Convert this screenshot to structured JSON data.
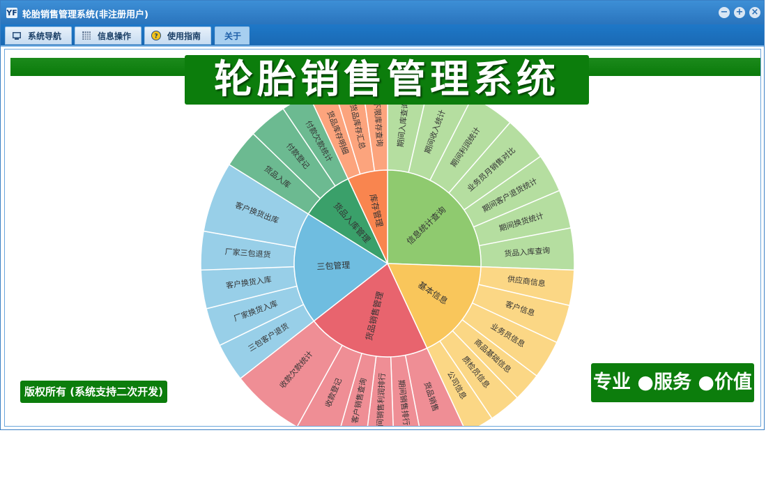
{
  "window": {
    "title": "轮胎销售管理系统(非注册用户)",
    "app_icon_text": "YF"
  },
  "menu": {
    "tabs": [
      {
        "label": "系统导航",
        "icon": "monitor-icon"
      },
      {
        "label": "信息操作",
        "icon": "grid-icon"
      },
      {
        "label": "使用指南",
        "icon": "help-icon"
      },
      {
        "label": "关于",
        "icon": ""
      }
    ],
    "active": "关于"
  },
  "banner": {
    "title": "轮胎销售管理系统"
  },
  "footer": {
    "copyright": "版权所有 (系统支持二次开发)",
    "slogan": "专业 ●服务 ●价值"
  },
  "colors": {
    "green": "#0c7d0c",
    "title_blue": "#3d8fd6",
    "stats": "#8fca6f",
    "basic": "#f9c65b",
    "sales": "#e8646e",
    "warranty": "#6fbde0",
    "stockin": "#3aa06a",
    "inventory": "#f9854f"
  },
  "sunburst": {
    "inner": [
      {
        "label": "信息统计查询",
        "color": "#8fca6f",
        "outer_color": "#b5dea0"
      },
      {
        "label": "基本信息",
        "color": "#f9c65b",
        "outer_color": "#fbd785"
      },
      {
        "label": "货品销售管理",
        "color": "#e8646e",
        "outer_color": "#ef8e95"
      },
      {
        "label": "三包管理",
        "color": "#6fbde0",
        "outer_color": "#98cfe8"
      },
      {
        "label": "货品入库管理",
        "color": "#3aa06a",
        "outer_color": "#6cba91"
      },
      {
        "label": "库存管理",
        "color": "#f9854f",
        "outer_color": "#fca47d"
      }
    ],
    "outer": [
      [
        {
          "label": "期间入库查询"
        },
        {
          "label": "期间收入统计"
        },
        {
          "label": "期间利润统计"
        },
        {
          "label": "业务员月销售对比"
        },
        {
          "label": "期间客户退货统计"
        },
        {
          "label": "期间换货统计"
        },
        {
          "label": "货品入库查询"
        }
      ],
      [
        {
          "label": "供应商信息"
        },
        {
          "label": "客户信息"
        },
        {
          "label": "业务员信息"
        },
        {
          "label": "商品基础信息"
        },
        {
          "label": "质检员信息"
        },
        {
          "label": "公司信息"
        }
      ],
      [
        {
          "label": "货品销售"
        },
        {
          "label": "期间销售排行"
        },
        {
          "label": "期间销售利润排行"
        },
        {
          "label": "客户销售查询"
        },
        {
          "label": "收款登记"
        },
        {
          "label": "收款欠款统计"
        }
      ],
      [
        {
          "label": "三包客户退货"
        },
        {
          "label": "厂家换货入库"
        },
        {
          "label": "客户换货入库"
        },
        {
          "label": "厂家三包退货"
        },
        {
          "label": "客户换货出库"
        }
      ],
      [
        {
          "label": "货品入库"
        },
        {
          "label": "付款登记"
        },
        {
          "label": "付款欠款统计"
        }
      ],
      [
        {
          "label": "货品库存明细"
        },
        {
          "label": "货品库存汇总"
        },
        {
          "label": "不限库存查询"
        }
      ]
    ]
  }
}
